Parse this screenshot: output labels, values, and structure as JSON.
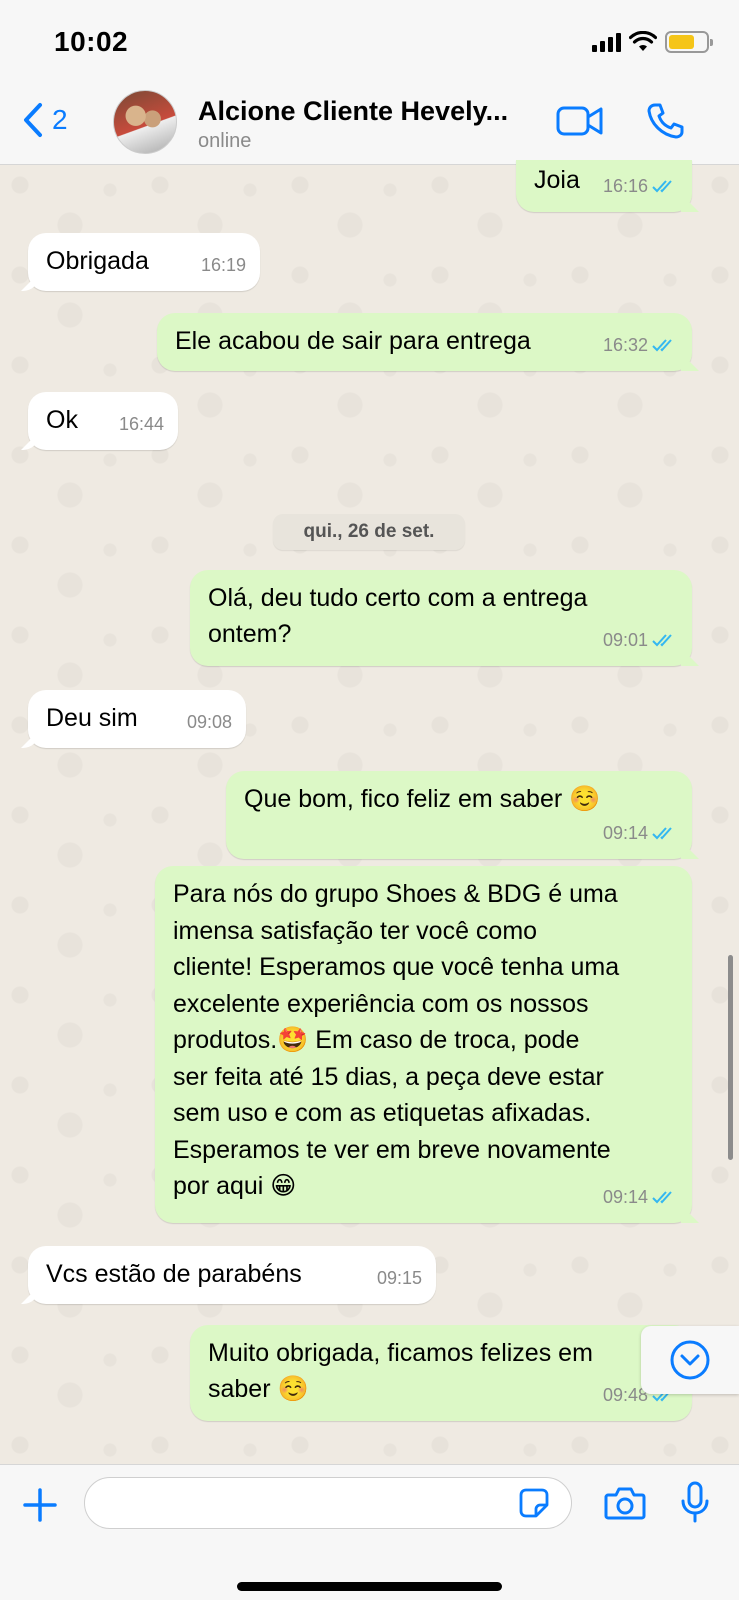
{
  "status_bar": {
    "time": "10:02"
  },
  "header": {
    "back_count": "2",
    "contact_name": "Alcione Cliente Hevely...",
    "contact_status": "online"
  },
  "messages": [
    {
      "direction": "out",
      "text": "Joia",
      "time": "16:16",
      "read": true
    },
    {
      "direction": "in",
      "text": "Obrigada",
      "time": "16:19"
    },
    {
      "direction": "out",
      "text": "Ele acabou de sair para entrega",
      "time": "16:32",
      "read": true
    },
    {
      "direction": "in",
      "text": "Ok",
      "time": "16:44"
    },
    {
      "direction": "out",
      "lines": [
        "Olá, deu tudo certo com a entrega",
        "ontem?"
      ],
      "time": "09:01",
      "read": true
    },
    {
      "direction": "in",
      "text": "Deu sim",
      "time": "09:08"
    },
    {
      "direction": "out",
      "text": "Que bom, fico feliz em saber ☺️",
      "time": "09:14",
      "read": true
    },
    {
      "direction": "out",
      "lines": [
        "Para nós do grupo Shoes & BDG é uma",
        "imensa satisfação ter você como",
        "cliente! Esperamos que você tenha uma",
        "excelente experiência com os nossos",
        "produtos.🤩 Em caso de troca, pode",
        "ser feita até 15 dias,  a peça deve estar",
        "sem uso e com as etiquetas afixadas.",
        "Esperamos te ver em breve novamente",
        "por aqui 😁"
      ],
      "time": "09:14",
      "read": true
    },
    {
      "direction": "in",
      "text": "Vcs estão de parabéns",
      "time": "09:15"
    },
    {
      "direction": "out",
      "lines": [
        "Muito obrigada, ficamos felizes em",
        "saber ☺️"
      ],
      "time": "09:48",
      "read": true
    }
  ],
  "date_separator": "qui., 26 de set.",
  "input": {
    "placeholder": ""
  },
  "colors": {
    "accent": "#0a7cff",
    "outgoing_bubble": "#dcf8c6",
    "incoming_bubble": "#ffffff",
    "read_ticks": "#34b7f1"
  }
}
